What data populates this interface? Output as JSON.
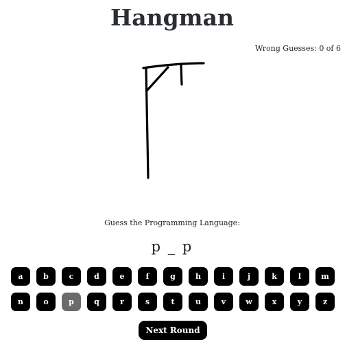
{
  "title": "Hangman",
  "status": {
    "wrong_guesses_text": "Wrong Guesses: 0 of 6"
  },
  "prompt": "Guess the Programming Language:",
  "word_display": "p _ p",
  "keyboard": {
    "row1": [
      {
        "letter": "a",
        "used": false
      },
      {
        "letter": "b",
        "used": false
      },
      {
        "letter": "c",
        "used": false
      },
      {
        "letter": "d",
        "used": false
      },
      {
        "letter": "e",
        "used": false
      },
      {
        "letter": "f",
        "used": false
      },
      {
        "letter": "g",
        "used": false
      },
      {
        "letter": "h",
        "used": false
      },
      {
        "letter": "i",
        "used": false
      },
      {
        "letter": "j",
        "used": false
      },
      {
        "letter": "k",
        "used": false
      },
      {
        "letter": "l",
        "used": false
      },
      {
        "letter": "m",
        "used": false
      }
    ],
    "row2": [
      {
        "letter": "n",
        "used": false
      },
      {
        "letter": "o",
        "used": false
      },
      {
        "letter": "p",
        "used": true
      },
      {
        "letter": "q",
        "used": false
      },
      {
        "letter": "r",
        "used": false
      },
      {
        "letter": "s",
        "used": false
      },
      {
        "letter": "t",
        "used": false
      },
      {
        "letter": "u",
        "used": false
      },
      {
        "letter": "v",
        "used": false
      },
      {
        "letter": "w",
        "used": false
      },
      {
        "letter": "x",
        "used": false
      },
      {
        "letter": "y",
        "used": false
      },
      {
        "letter": "z",
        "used": false
      }
    ]
  },
  "next_round_label": "Next Round",
  "colors": {
    "key_bg": "#000000",
    "key_used_bg": "#6b6b6b",
    "key_text": "#ffffff",
    "title": "#2a2d31"
  }
}
